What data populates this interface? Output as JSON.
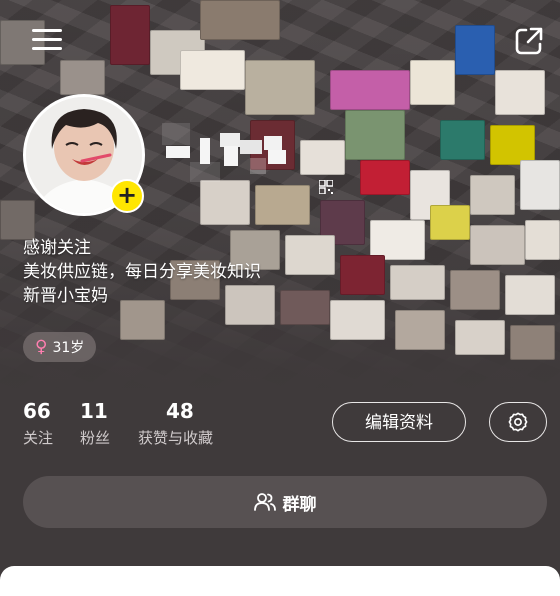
{
  "header": {
    "menu_icon": "hamburger-menu-icon",
    "share_icon": "external-share-icon"
  },
  "profile": {
    "follow_badge": "+",
    "bio_lines": [
      "感谢关注",
      "美妆供应链，每日分享美妆知识",
      "新晋小宝妈"
    ],
    "gender_symbol": "♀",
    "age_label": "31岁"
  },
  "stats": [
    {
      "value": "66",
      "label": "关注"
    },
    {
      "value": "11",
      "label": "粉丝"
    },
    {
      "value": "48",
      "label": "获赞与收藏"
    }
  ],
  "actions": {
    "edit_label": "编辑资料",
    "settings_icon": "gear-icon",
    "group_label": "群聊",
    "group_icon": "people-icon"
  },
  "colors": {
    "accent_yellow": "#ffe600",
    "female_pink": "#ff7fb0",
    "surface": "#3f3a3b",
    "button_fill": "#575152"
  }
}
